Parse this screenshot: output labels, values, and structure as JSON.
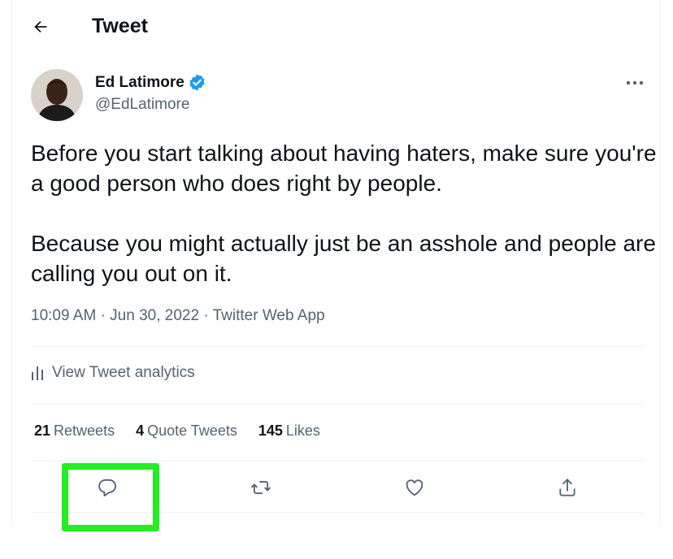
{
  "header": {
    "title": "Tweet",
    "back_icon": "arrow-left-icon"
  },
  "author": {
    "name": "Ed Latimore",
    "handle": "@EdLatimore",
    "verified": true,
    "verified_color": "#1d9bf0"
  },
  "tweet": {
    "paragraphs": [
      "Before you start talking about having haters, make sure you're a good person who does right by people.",
      "Because you might actually just be an asshole and people are calling you out on it."
    ],
    "time": "10:09 AM",
    "date": "Jun 30, 2022",
    "source": "Twitter Web App",
    "separator": "·"
  },
  "analytics": {
    "label": "View Tweet analytics",
    "icon": "analytics-bars-icon"
  },
  "stats": {
    "retweets_count": "21",
    "retweets_label": "Retweets",
    "quotes_count": "4",
    "quotes_label": "Quote Tweets",
    "likes_count": "145",
    "likes_label": "Likes"
  },
  "actions": [
    "reply-icon",
    "retweet-icon",
    "like-icon",
    "share-icon"
  ],
  "colors": {
    "text": "#0f1419",
    "secondary": "#536471",
    "divider": "#eff3f4",
    "highlight": "#22ee22"
  }
}
